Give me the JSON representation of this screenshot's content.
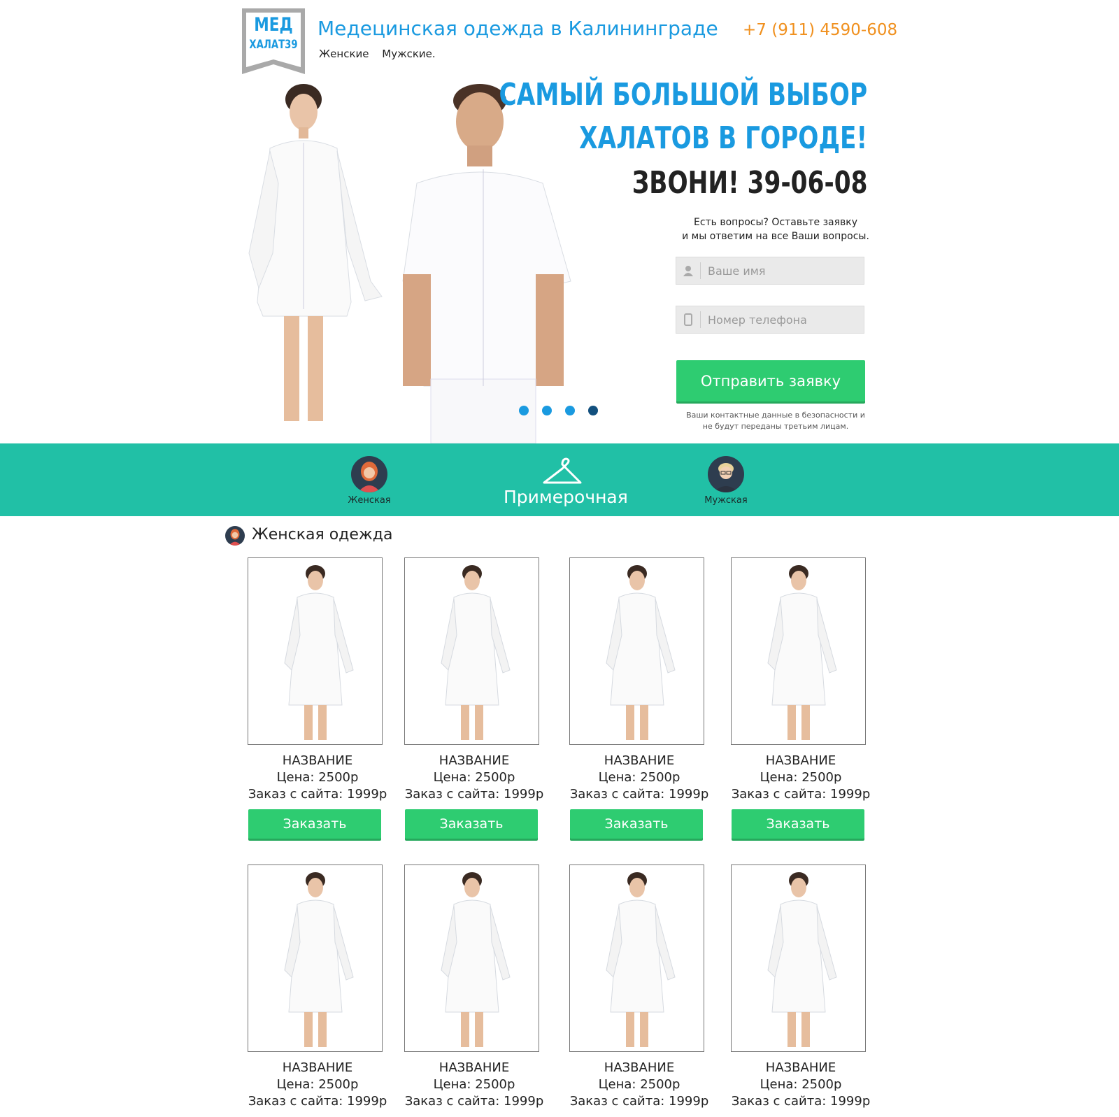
{
  "header": {
    "logo_top": "МЕД",
    "logo_bottom": "ХАЛАТ39",
    "title": "Медецинская одежда в Калининграде",
    "phone": "+7 (911) 4590-608",
    "nav": [
      "Женские",
      "Мужские."
    ]
  },
  "hero": {
    "headline1": "САМЫЙ БОЛЬШОЙ ВЫБОР",
    "headline2": "ХАЛАТОВ В ГОРОДЕ!",
    "headline3": "ЗВОНИ! 39-06-08",
    "form_desc_1": "Есть вопросы? Оставьте заявку",
    "form_desc_2": "и мы ответим на все Ваши вопросы.",
    "name_placeholder": "Ваше имя",
    "phone_placeholder": "Номер телефона",
    "submit_label": "Отправить заявку",
    "privacy_1": "Ваши контактные данные в безопасности и",
    "privacy_2": "не будут переданы третьим лицам.",
    "slider_dots": 4,
    "active_dot": 3
  },
  "band": {
    "women_label": "Женская",
    "title": "Примерочная",
    "men_label": "Мужская"
  },
  "section": {
    "title": "Женская одежда"
  },
  "products": [
    {
      "name": "НАЗВАНИЕ",
      "price": "Цена: 2500р",
      "site": "Заказ с сайта: 1999р",
      "button": "Заказать"
    },
    {
      "name": "НАЗВАНИЕ",
      "price": "Цена: 2500р",
      "site": "Заказ с сайта: 1999р",
      "button": "Заказать"
    },
    {
      "name": "НАЗВАНИЕ",
      "price": "Цена: 2500р",
      "site": "Заказ с сайта: 1999р",
      "button": "Заказать"
    },
    {
      "name": "НАЗВАНИЕ",
      "price": "Цена: 2500р",
      "site": "Заказ с сайта: 1999р",
      "button": "Заказать"
    },
    {
      "name": "НАЗВАНИЕ",
      "price": "Цена: 2500р",
      "site": "Заказ с сайта: 1999р"
    },
    {
      "name": "НАЗВАНИЕ",
      "price": "Цена: 2500р",
      "site": "Заказ с сайта: 1999р"
    },
    {
      "name": "НАЗВАНИЕ",
      "price": "Цена: 2500р",
      "site": "Заказ с сайта: 1999р"
    },
    {
      "name": "НАЗВАНИЕ",
      "price": "Цена: 2500р",
      "site": "Заказ с сайта: 1999р"
    }
  ],
  "colors": {
    "brand_blue": "#1a9ae0",
    "phone_orange": "#f0901e",
    "accent_green": "#2ecc71",
    "band_teal": "#21c0a6"
  }
}
